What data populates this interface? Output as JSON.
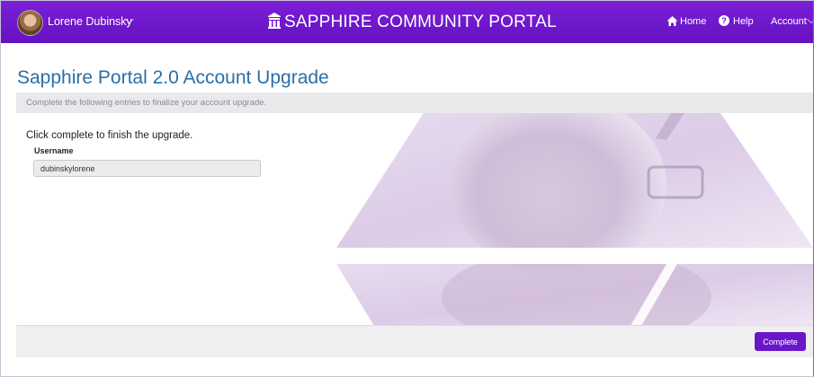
{
  "header": {
    "user_name": "Lorene Dubinsky",
    "portal_title": "SAPPHIRE COMMUNITY PORTAL",
    "nav": {
      "home": "Home",
      "help": "Help",
      "account": "Account"
    },
    "colors": {
      "bar": "#6a16c8"
    }
  },
  "page": {
    "title": "Sapphire Portal 2.0 Account Upgrade",
    "instructions": "Complete the following entries to finalize your account upgrade.",
    "message": "Click complete to finish the upgrade.",
    "username_label": "Username",
    "username_value": "dubinskylorene"
  },
  "footer": {
    "complete_label": "Complete"
  },
  "icons": [
    "avatar",
    "chevron-down-icon",
    "building-icon",
    "home-icon",
    "help-icon"
  ]
}
